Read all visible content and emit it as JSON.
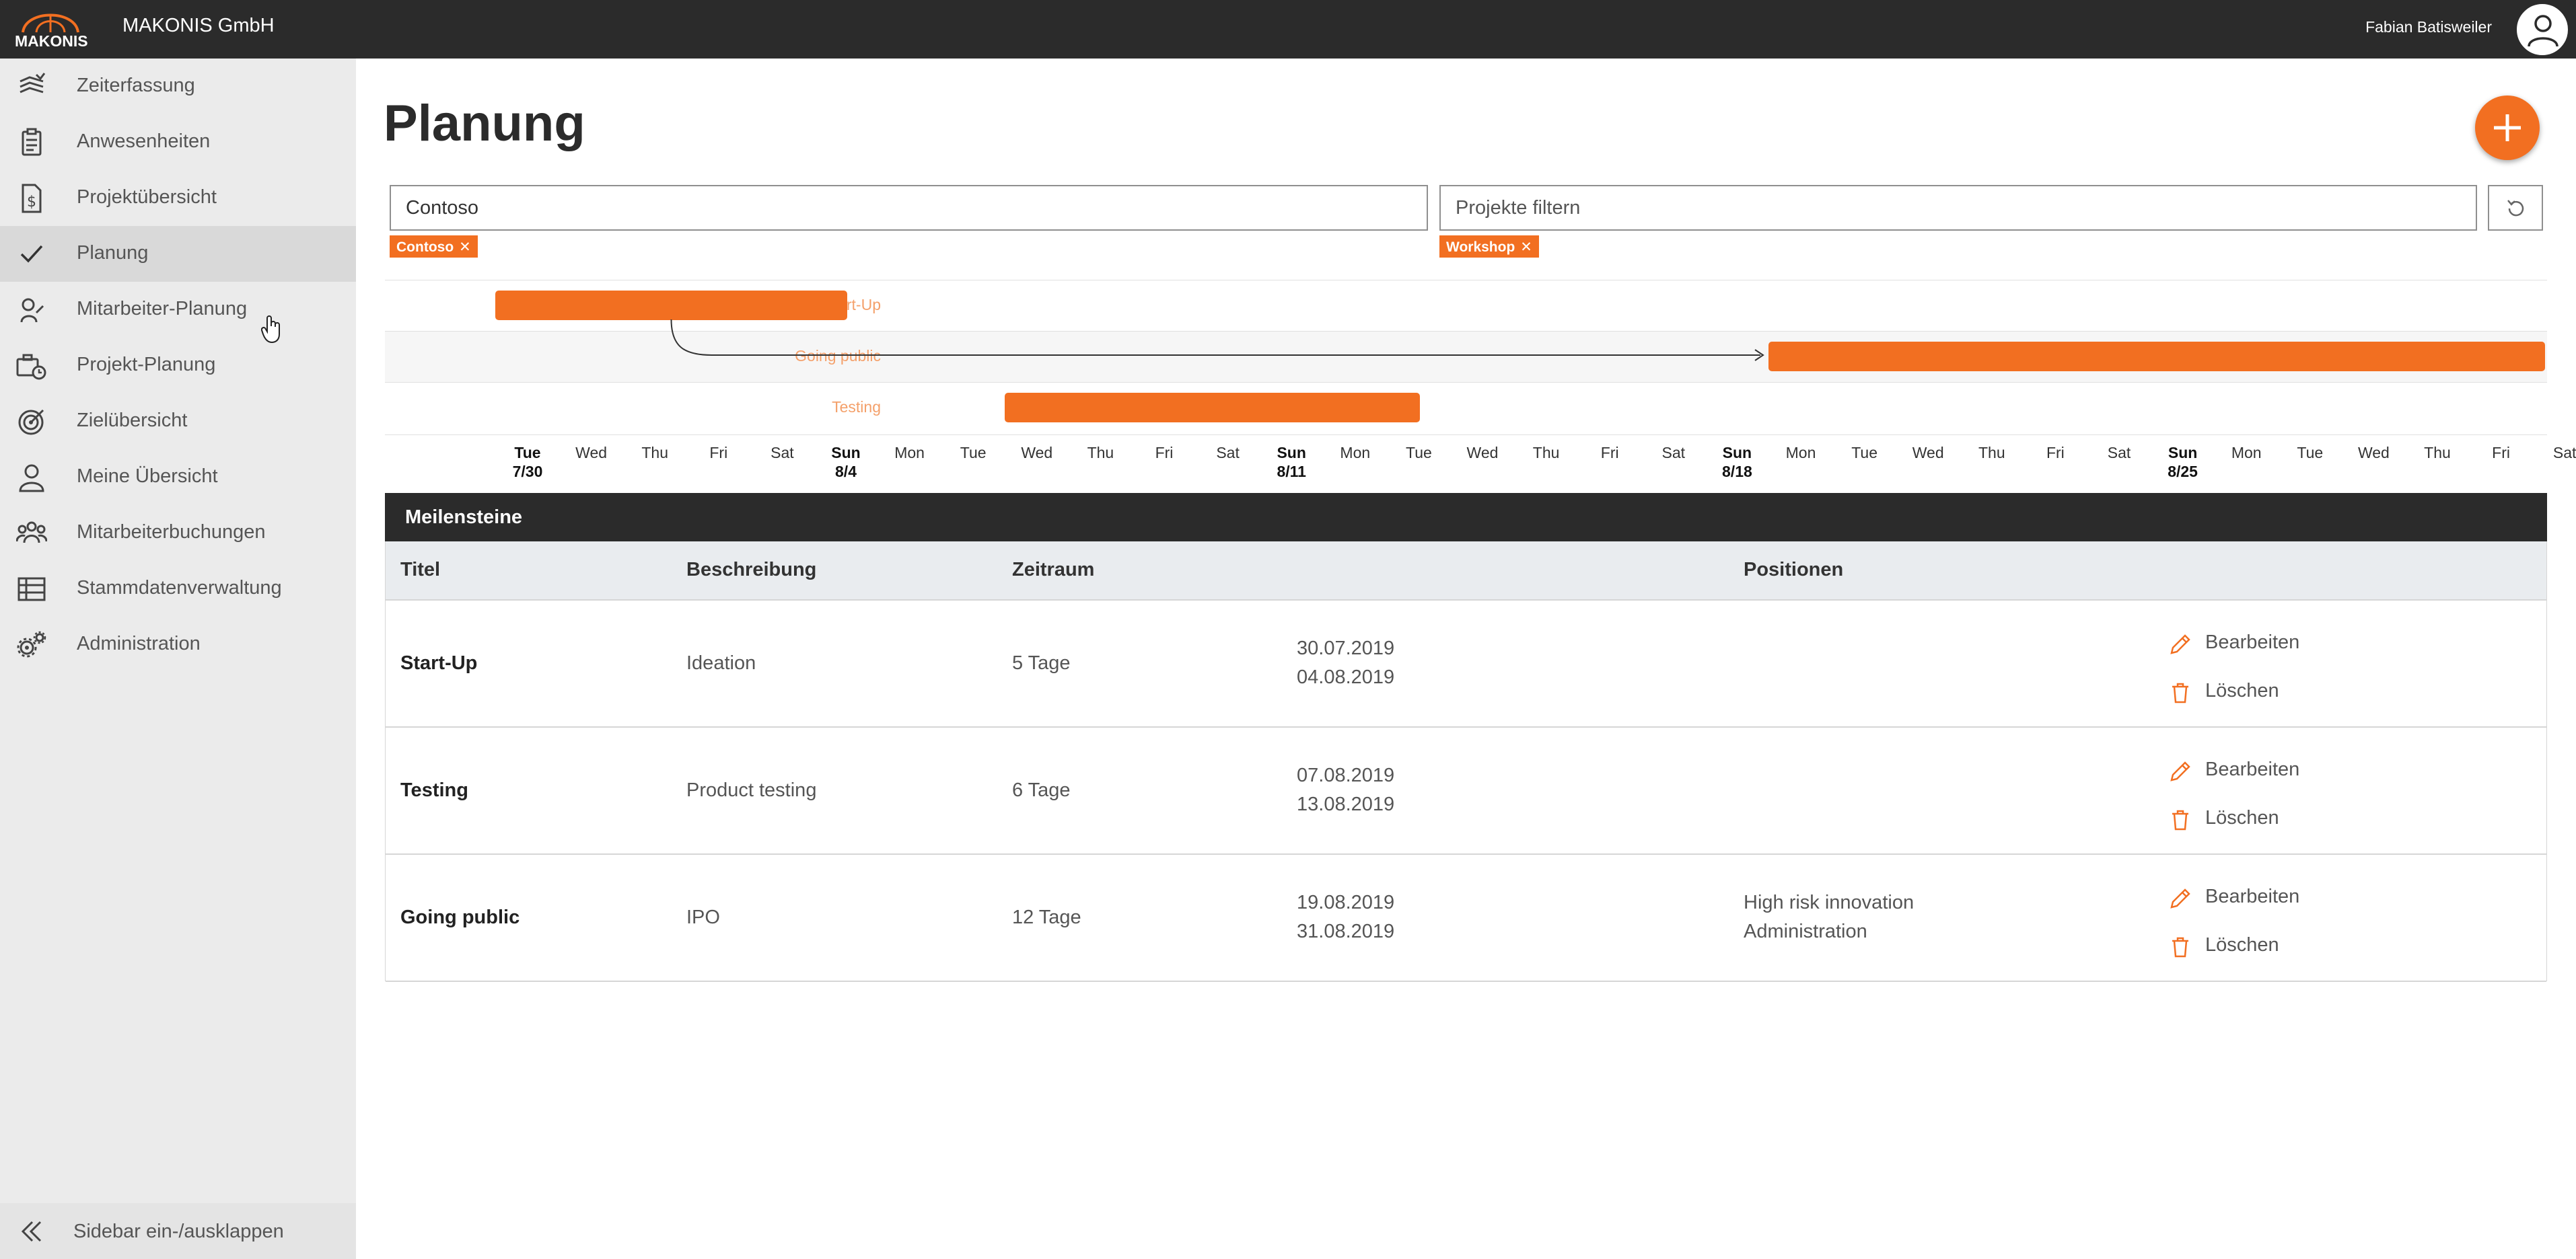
{
  "header": {
    "logo_text": "MAKONIS",
    "company": "MAKONIS GmbH",
    "user_name": "Fabian Batisweiler"
  },
  "sidebar": {
    "items": [
      {
        "label": "Zeiterfassung",
        "icon": "time-tracking-icon"
      },
      {
        "label": "Anwesenheiten",
        "icon": "clipboard-icon"
      },
      {
        "label": "Projektübersicht",
        "icon": "money-document-icon"
      },
      {
        "label": "Planung",
        "icon": "checkmark-icon",
        "active": true
      },
      {
        "label": "Mitarbeiter-Planung",
        "icon": "person-edit-icon"
      },
      {
        "label": "Projekt-Planung",
        "icon": "briefcase-clock-icon"
      },
      {
        "label": "Zielübersicht",
        "icon": "target-icon"
      },
      {
        "label": "Meine Übersicht",
        "icon": "user-icon"
      },
      {
        "label": "Mitarbeiterbuchungen",
        "icon": "team-icon"
      },
      {
        "label": "Stammdatenverwaltung",
        "icon": "table-icon"
      },
      {
        "label": "Administration",
        "icon": "gears-icon"
      }
    ],
    "toggle_label": "Sidebar ein-/ausklappen"
  },
  "main": {
    "title": "Planung",
    "filters": {
      "customer_value": "Contoso",
      "project_placeholder": "Projekte filtern",
      "customer_chip": "Contoso",
      "project_chip": "Workshop",
      "chip_remove": "✕"
    }
  },
  "chart_data": {
    "type": "gantt",
    "rows": [
      {
        "name": "Start-Up",
        "start": "2019-07-30",
        "end": "2019-08-04"
      },
      {
        "name": "Going public",
        "start": "2019-08-19",
        "end": "2019-08-31"
      },
      {
        "name": "Testing",
        "start": "2019-08-07",
        "end": "2019-08-13"
      }
    ],
    "dependencies": [
      {
        "from": "Start-Up",
        "to": "Going public"
      }
    ],
    "x_range": [
      "2019-07-30",
      "2019-08-31"
    ],
    "ticks": [
      {
        "day": "Tue",
        "date": "7/30",
        "bold": true
      },
      {
        "day": "Wed"
      },
      {
        "day": "Thu"
      },
      {
        "day": "Fri"
      },
      {
        "day": "Sat"
      },
      {
        "day": "Sun",
        "date": "8/4",
        "bold": true
      },
      {
        "day": "Mon"
      },
      {
        "day": "Tue"
      },
      {
        "day": "Wed"
      },
      {
        "day": "Thu"
      },
      {
        "day": "Fri"
      },
      {
        "day": "Sat"
      },
      {
        "day": "Sun",
        "date": "8/11",
        "bold": true
      },
      {
        "day": "Mon"
      },
      {
        "day": "Tue"
      },
      {
        "day": "Wed"
      },
      {
        "day": "Thu"
      },
      {
        "day": "Fri"
      },
      {
        "day": "Sat"
      },
      {
        "day": "Sun",
        "date": "8/18",
        "bold": true
      },
      {
        "day": "Mon"
      },
      {
        "day": "Tue"
      },
      {
        "day": "Wed"
      },
      {
        "day": "Thu"
      },
      {
        "day": "Fri"
      },
      {
        "day": "Sat"
      },
      {
        "day": "Sun",
        "date": "8/25",
        "bold": true
      },
      {
        "day": "Mon"
      },
      {
        "day": "Tue"
      },
      {
        "day": "Wed"
      },
      {
        "day": "Thu"
      },
      {
        "day": "Fri"
      },
      {
        "day": "Sat"
      }
    ],
    "bar_color": "#f26f21"
  },
  "milestones": {
    "section_title": "Meilensteine",
    "columns": [
      "Titel",
      "Beschreibung",
      "Zeitraum",
      "Positionen"
    ],
    "rows": [
      {
        "title": "Start-Up",
        "description": "Ideation",
        "duration": "5 Tage",
        "start": "30.07.2019",
        "end": "04.08.2019",
        "positions": [
          "",
          ""
        ]
      },
      {
        "title": "Testing",
        "description": "Product testing",
        "duration": "6 Tage",
        "start": "07.08.2019",
        "end": "13.08.2019",
        "positions": [
          "",
          ""
        ]
      },
      {
        "title": "Going public",
        "description": "IPO",
        "duration": "12 Tage",
        "start": "19.08.2019",
        "end": "31.08.2019",
        "positions": [
          "High risk innovation",
          "Administration"
        ]
      }
    ],
    "edit_label": "Bearbeiten",
    "delete_label": "Löschen"
  },
  "colors": {
    "accent": "#f26f21",
    "header_bg": "#2b2b2b",
    "sidebar_bg": "#ebebeb"
  }
}
